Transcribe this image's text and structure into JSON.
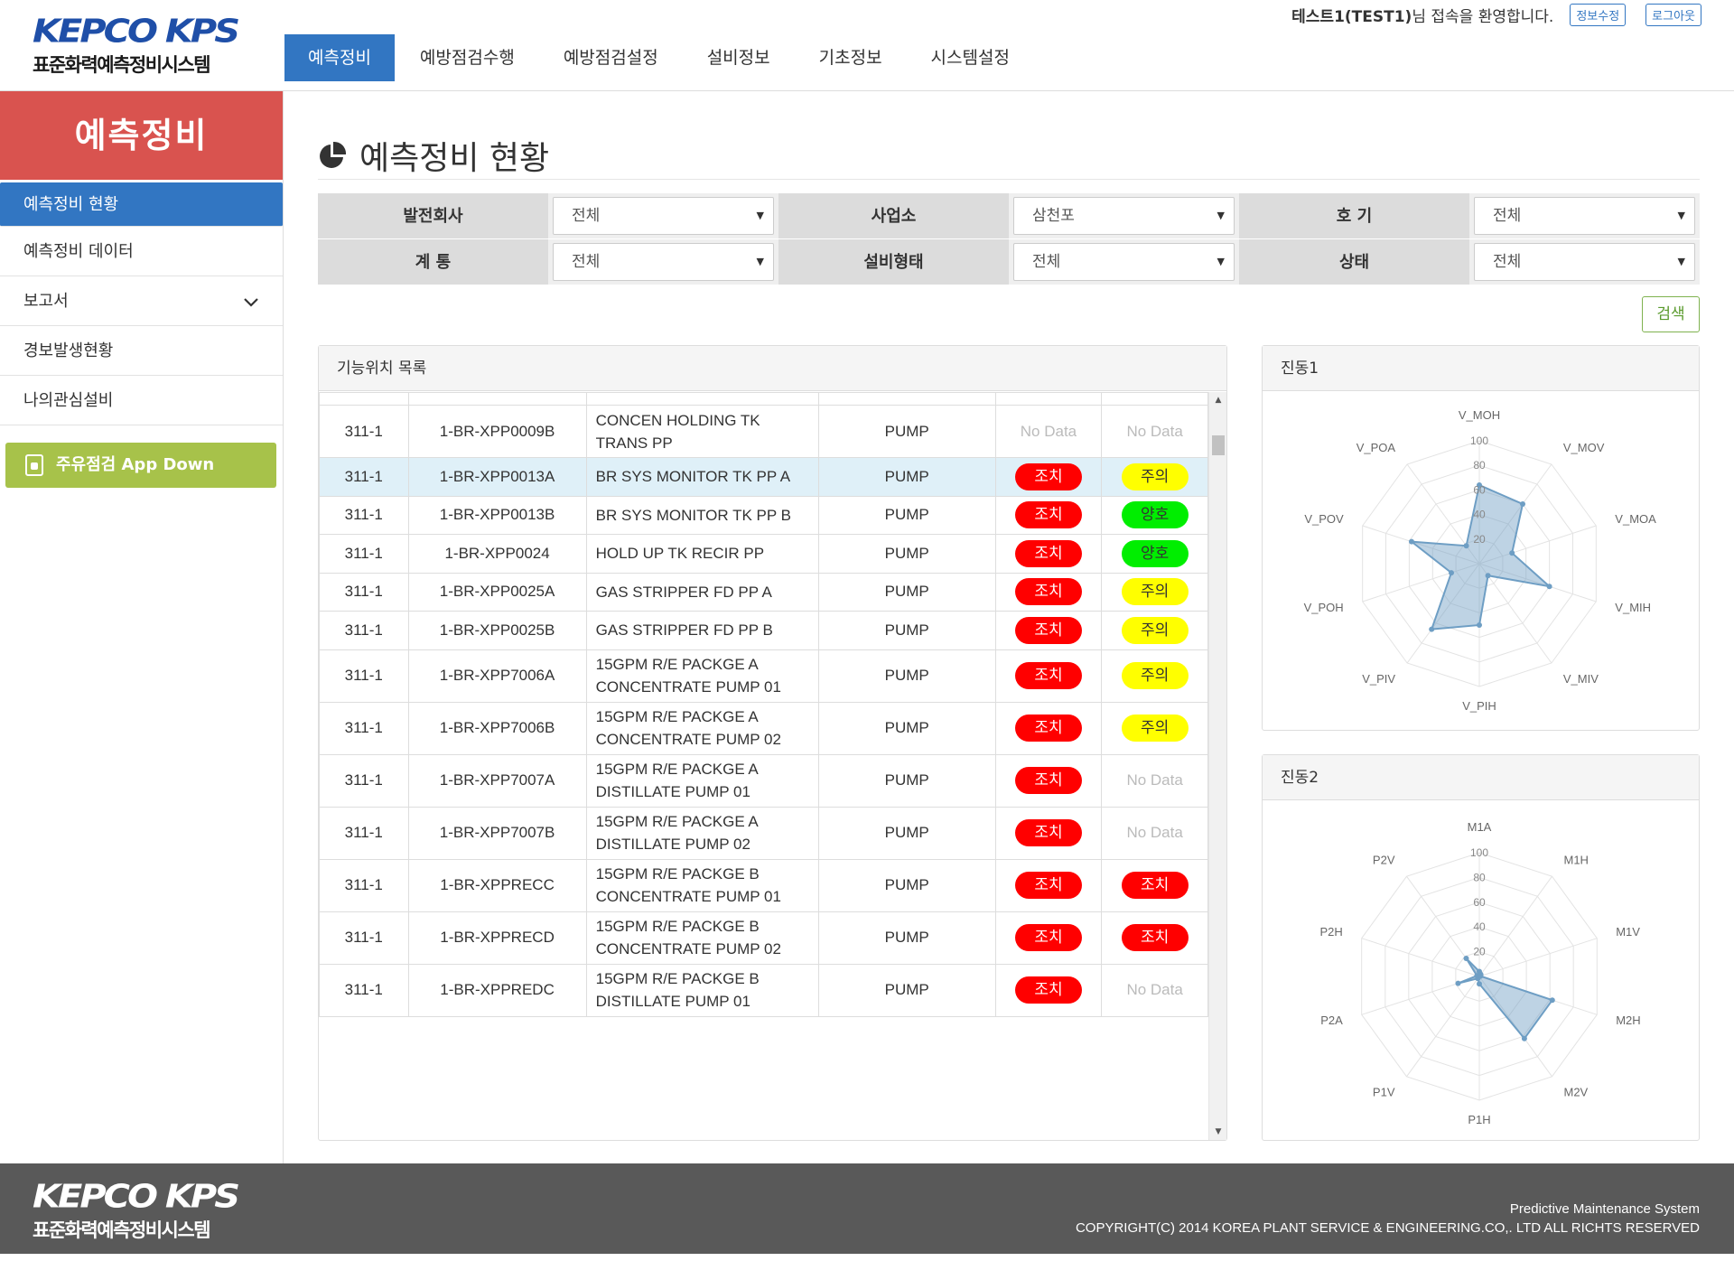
{
  "header": {
    "logo_brand": "KEPCO KPS",
    "logo_sub": "표준화력예측정비시스템",
    "user_name": "테스트1(TEST1)",
    "welcome_suffix": "님 접속을 환영합니다.",
    "edit_info": "정보수정",
    "logout": "로그아웃"
  },
  "nav": {
    "items": [
      "예측정비",
      "예방점검수행",
      "예방점검설정",
      "설비정보",
      "기초정보",
      "시스템설정"
    ]
  },
  "sidebar": {
    "title": "예측정비",
    "items": [
      {
        "label": "예측정비 현황"
      },
      {
        "label": "예측정비 데이터"
      },
      {
        "label": "보고서"
      },
      {
        "label": "경보발생현황"
      },
      {
        "label": "나의관심설비"
      }
    ],
    "app_button": "주유점검 App Down"
  },
  "page": {
    "title": "예측정비 현황"
  },
  "filters": {
    "company_label": "발전회사",
    "company_value": "전체",
    "site_label": "사업소",
    "site_value": "삼천포",
    "unit_label": "호 기",
    "unit_value": "전체",
    "system_label": "계 통",
    "system_value": "전체",
    "eqtype_label": "설비형태",
    "eqtype_value": "전체",
    "status_label": "상태",
    "status_value": "전체"
  },
  "search_button": "검색",
  "list": {
    "title": "기능위치 목록",
    "rows": [
      {
        "code": "311-1",
        "tag": "1-BR-XPP0009B",
        "desc1": "CONCEN HOLDING TK",
        "desc2": "TRANS PP",
        "type": "PUMP",
        "s1": "No Data",
        "s2": "No Data"
      },
      {
        "code": "311-1",
        "tag": "1-BR-XPP0013A",
        "desc1": "BR SYS MONITOR TK PP A",
        "desc2": "",
        "type": "PUMP",
        "s1": "조치",
        "s2": "주의"
      },
      {
        "code": "311-1",
        "tag": "1-BR-XPP0013B",
        "desc1": "BR SYS MONITOR TK PP B",
        "desc2": "",
        "type": "PUMP",
        "s1": "조치",
        "s2": "양호"
      },
      {
        "code": "311-1",
        "tag": "1-BR-XPP0024",
        "desc1": "HOLD UP TK RECIR PP",
        "desc2": "",
        "type": "PUMP",
        "s1": "조치",
        "s2": "양호"
      },
      {
        "code": "311-1",
        "tag": "1-BR-XPP0025A",
        "desc1": "GAS STRIPPER FD PP A",
        "desc2": "",
        "type": "PUMP",
        "s1": "조치",
        "s2": "주의"
      },
      {
        "code": "311-1",
        "tag": "1-BR-XPP0025B",
        "desc1": "GAS STRIPPER FD PP B",
        "desc2": "",
        "type": "PUMP",
        "s1": "조치",
        "s2": "주의"
      },
      {
        "code": "311-1",
        "tag": "1-BR-XPP7006A",
        "desc1": "15GPM R/E PACKGE A",
        "desc2": "CONCENTRATE PUMP 01",
        "type": "PUMP",
        "s1": "조치",
        "s2": "주의"
      },
      {
        "code": "311-1",
        "tag": "1-BR-XPP7006B",
        "desc1": "15GPM R/E PACKGE A",
        "desc2": "CONCENTRATE PUMP 02",
        "type": "PUMP",
        "s1": "조치",
        "s2": "주의"
      },
      {
        "code": "311-1",
        "tag": "1-BR-XPP7007A",
        "desc1": "15GPM R/E PACKGE A",
        "desc2": "DISTILLATE PUMP 01",
        "type": "PUMP",
        "s1": "조치",
        "s2": "No Data"
      },
      {
        "code": "311-1",
        "tag": "1-BR-XPP7007B",
        "desc1": "15GPM R/E PACKGE A",
        "desc2": "DISTILLATE PUMP 02",
        "type": "PUMP",
        "s1": "조치",
        "s2": "No Data"
      },
      {
        "code": "311-1",
        "tag": "1-BR-XPPRECC",
        "desc1": "15GPM R/E PACKGE B",
        "desc2": "CONCENTRATE PUMP 01",
        "type": "PUMP",
        "s1": "조치",
        "s2": "조치"
      },
      {
        "code": "311-1",
        "tag": "1-BR-XPPRECD",
        "desc1": "15GPM R/E PACKGE B",
        "desc2": "CONCENTRATE PUMP 02",
        "type": "PUMP",
        "s1": "조치",
        "s2": "조치"
      },
      {
        "code": "311-1",
        "tag": "1-BR-XPPREDC",
        "desc1": "15GPM R/E PACKGE B",
        "desc2": "DISTILLATE PUMP 01",
        "type": "PUMP",
        "s1": "조치",
        "s2": "No Data"
      }
    ]
  },
  "status_colors": {
    "조치": {
      "bg": "#ff0000",
      "fg": "#ffffff"
    },
    "주의": {
      "bg": "#ffff00",
      "fg": "#333333"
    },
    "양호": {
      "bg": "#00ee00",
      "fg": "#333333"
    }
  },
  "chart_data": [
    {
      "type": "radar",
      "title": "진동1",
      "axes": [
        "V_MOH",
        "V_MOV",
        "V_MOA",
        "V_MIH",
        "V_MIV",
        "V_PIH",
        "V_PIV",
        "V_POH",
        "V_POV",
        "V_POA"
      ],
      "values": [
        64,
        60,
        28,
        60,
        12,
        50,
        66,
        24,
        58,
        18
      ],
      "rlim": [
        0,
        100
      ],
      "ticks": [
        20,
        40,
        60,
        80,
        100
      ],
      "color": "#6e9ec4"
    },
    {
      "type": "radar",
      "title": "진동2",
      "axes": [
        "M1A",
        "M1H",
        "M1V",
        "M2H",
        "M2V",
        "P1H",
        "P1V",
        "P2A",
        "P2H",
        "P2V"
      ],
      "values": [
        4,
        2,
        1,
        62,
        62,
        6,
        2,
        18,
        2,
        18
      ],
      "rlim": [
        0,
        100
      ],
      "ticks": [
        20,
        40,
        60,
        80,
        100
      ],
      "color": "#6e9ec4"
    }
  ],
  "footer": {
    "line1": "Predictive Maintenance System",
    "line2": "COPYRIGHT(C) 2014 KOREA PLANT SERVICE & ENGINEERING.CO,. LTD ALL RICHTS RESERVED"
  }
}
